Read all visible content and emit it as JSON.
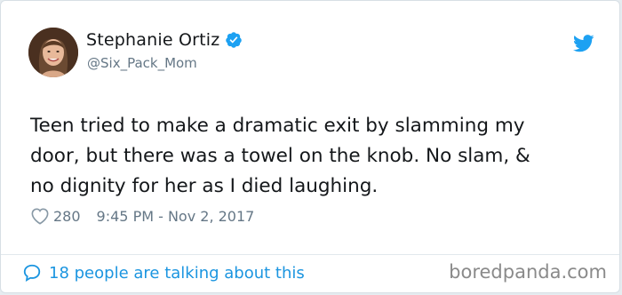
{
  "author": {
    "name": "Stephanie Ortiz",
    "handle": "@Six_Pack_Mom",
    "verified": true
  },
  "tweet": {
    "text_lines": [
      "Teen tried to make a dramatic exit by slamming my",
      "door, but there was a towel on the knob. No slam, &",
      "no dignity for her as I died laughing."
    ],
    "likes": "280",
    "timestamp": "9:45 PM - Nov 2, 2017"
  },
  "footer": {
    "talking_label": "18 people are talking about this",
    "watermark": "boredpanda.com"
  },
  "colors": {
    "twitter_blue": "#1da1f2",
    "link_blue": "#1b95e0",
    "text_dark": "#14171a",
    "text_gray": "#657786"
  },
  "icons": {
    "verified": "verified-badge-icon",
    "brand": "twitter-bird-icon",
    "likes": "heart-icon",
    "talking": "speech-bubble-icon"
  }
}
